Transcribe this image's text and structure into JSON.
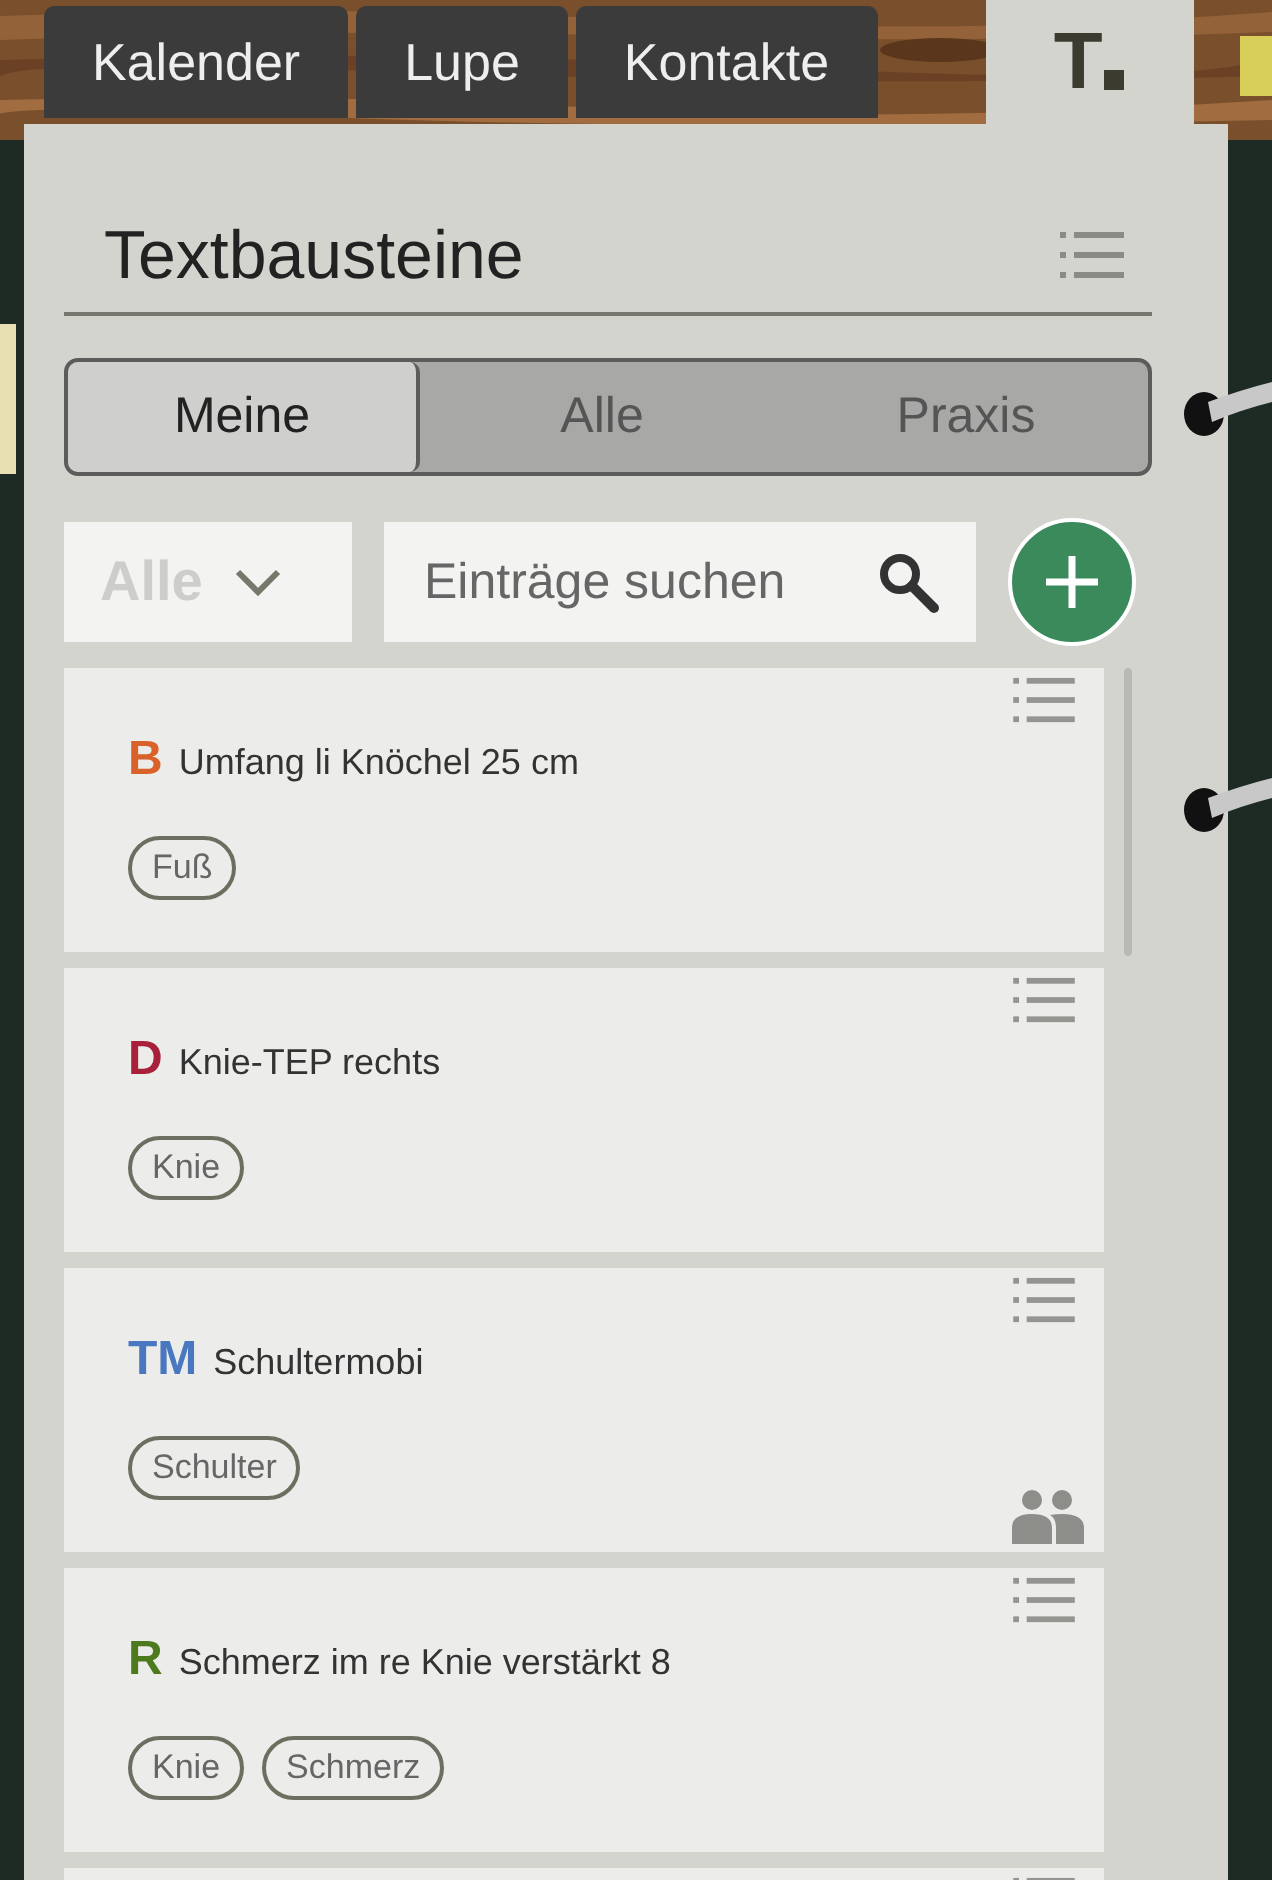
{
  "tabs": [
    {
      "label": "Kalender",
      "kind": "text",
      "selected": false
    },
    {
      "label": "Lupe",
      "kind": "text",
      "selected": false
    },
    {
      "label": "Kontakte",
      "kind": "text",
      "selected": false
    },
    {
      "label": "T",
      "kind": "logo",
      "selected": true
    }
  ],
  "panel": {
    "title": "Textbausteine"
  },
  "scope": [
    {
      "label": "Meine",
      "selected": true
    },
    {
      "label": "Alle",
      "selected": false
    },
    {
      "label": "Praxis",
      "selected": false
    }
  ],
  "filter": {
    "value": "Alle"
  },
  "search": {
    "placeholder": "Einträge suchen"
  },
  "entries": [
    {
      "abbr": "B",
      "color": "#d9622b",
      "title": "Umfang li Knöchel 25 cm",
      "tags": [
        "Fuß"
      ],
      "shared": false
    },
    {
      "abbr": "D",
      "color": "#a8203a",
      "title": "Knie-TEP rechts",
      "tags": [
        "Knie"
      ],
      "shared": false
    },
    {
      "abbr": "TM",
      "color": "#4a78c0",
      "title": "Schultermobi",
      "tags": [
        "Schulter"
      ],
      "shared": true
    },
    {
      "abbr": "R",
      "color": "#4e7a1e",
      "title": "Schmerz im re Knie verstärkt 8",
      "tags": [
        "Knie",
        "Schmerz"
      ],
      "shared": false
    }
  ],
  "more_entries_below": true
}
